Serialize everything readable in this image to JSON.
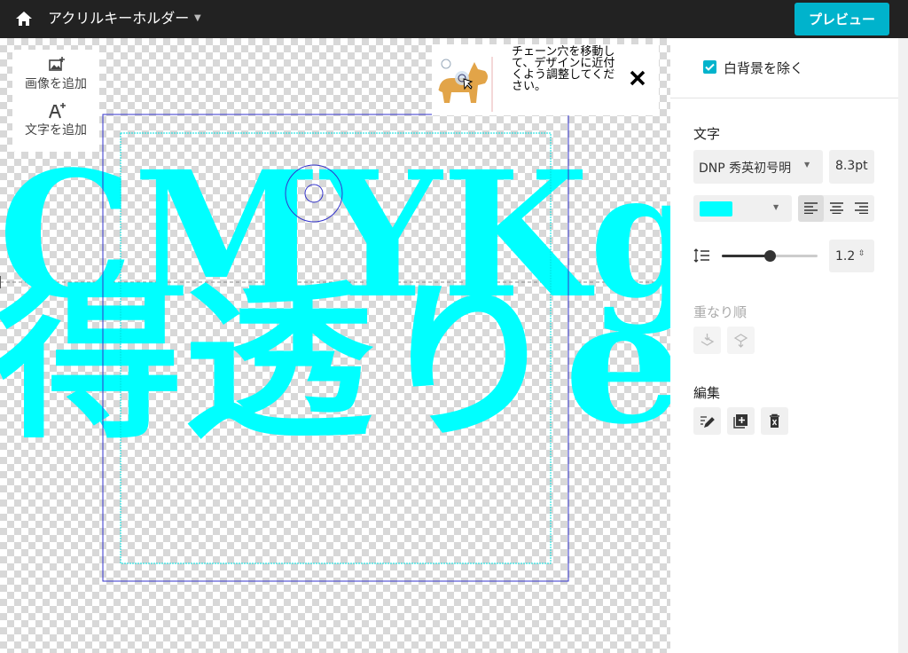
{
  "topbar": {
    "title": "アクリルキーホルダー",
    "preview_label": "プレビュー"
  },
  "tools": {
    "add_image_label": "画像を追加",
    "add_text_label": "文字を追加"
  },
  "tooltip": {
    "text": "チェーン穴を移動して、デザインに近付くよう調整してください。"
  },
  "canvas": {
    "text_color": "#00ffff",
    "text_line1": "CMYKg",
    "text_line2": "得透りe"
  },
  "panel": {
    "remove_white_bg_label": "白背景を除く",
    "remove_white_bg_checked": true,
    "text_section_title": "文字",
    "font_name": "DNP 秀英初号明",
    "font_size": "8.3pt",
    "text_color": "#00ffff",
    "line_height_value": "1.2",
    "line_height_slider_fraction": 0.5,
    "order_section_title": "重なり順",
    "edit_section_title": "編集"
  },
  "colors": {
    "topbar": "#222222",
    "accent": "#00b3cc",
    "guide_blue": "#3333cc",
    "guide_cyan": "#00ffff"
  }
}
